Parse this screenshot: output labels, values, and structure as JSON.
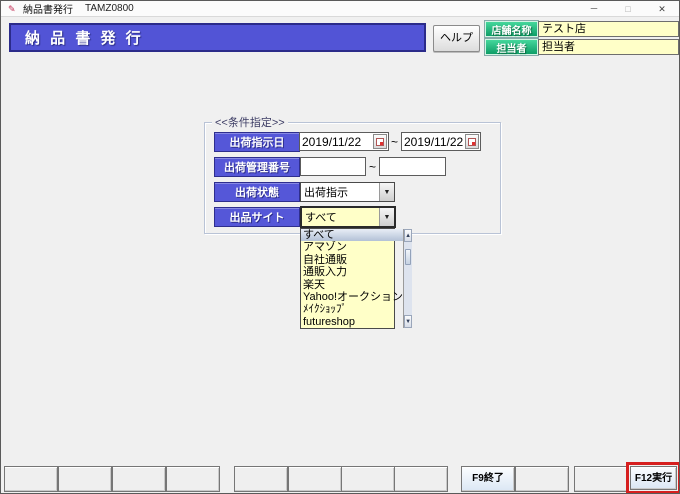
{
  "window": {
    "title": "納品書発行",
    "code": "TAMZ0800",
    "controls": {
      "minimize": "－",
      "maximize": "□",
      "close": "✕"
    }
  },
  "header": {
    "title": "納 品 書 発 行",
    "help_button": "ヘルプ",
    "store": {
      "label": "店舗名称",
      "value": "テスト店"
    },
    "staff": {
      "label": "担当者",
      "value": "担当者"
    }
  },
  "conditions": {
    "legend": "<<条件指定>>",
    "tilde": "~",
    "ship_date": {
      "label": "出荷指示日",
      "from": "2019/11/22",
      "to": "2019/11/22"
    },
    "mgmt_no": {
      "label": "出荷管理番号",
      "from": "",
      "to": ""
    },
    "ship_status": {
      "label": "出荷状態",
      "value": "出荷指示"
    },
    "listing_site": {
      "label": "出品サイト",
      "value": "すべて"
    }
  },
  "dropdown": {
    "items": [
      "すべて",
      "アマゾン",
      "自社通販",
      "通販入力",
      "楽天",
      "Yahoo!オークション",
      "ﾒｲｸｼｮｯﾌﾟ",
      "futureshop"
    ],
    "selected_index": 0
  },
  "icons": {
    "dropdown_arrow": "▼",
    "scroll_up": "▲",
    "scroll_down": "▼",
    "app_glyph": "✎"
  },
  "footer": {
    "f9_label": "F9終了",
    "f12_label": "F12実行"
  },
  "colors": {
    "header_blue": "#5254d6",
    "label_blue": "#5557d8",
    "label_green": "#12ab72",
    "field_yellow": "#ffffc8",
    "highlight_red": "#d61f1f"
  }
}
